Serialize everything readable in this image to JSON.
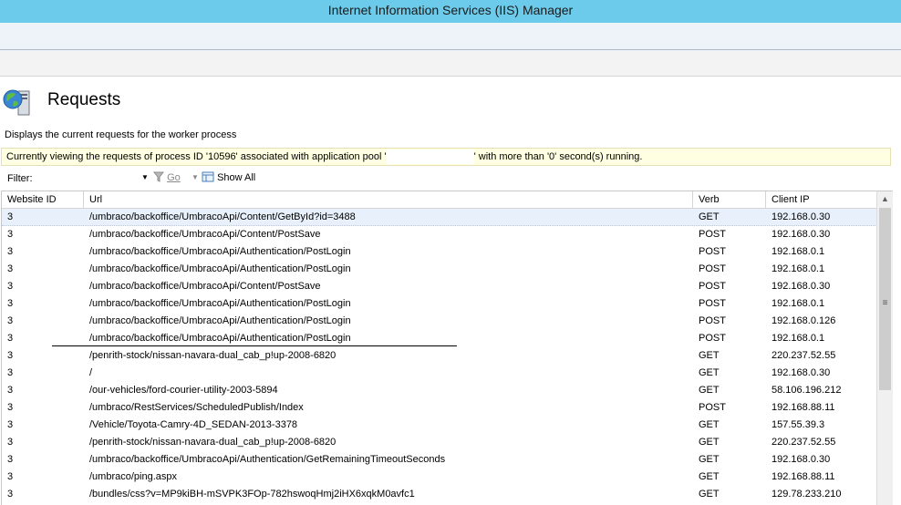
{
  "window": {
    "title": "Internet Information Services (IIS) Manager"
  },
  "page": {
    "title": "Requests",
    "description": "Displays the current requests for the worker process",
    "icon": "globe-server-icon"
  },
  "infobar": {
    "text_before": "Currently viewing the requests of process ID '10596' associated with application pool '",
    "text_after": "' with more than '0' second(s) running."
  },
  "filter": {
    "label": "Filter:",
    "value": "",
    "go_label": "Go",
    "show_all_label": "Show All"
  },
  "grid": {
    "columns": [
      "Website ID",
      "Url",
      "Verb",
      "Client IP"
    ],
    "rows": [
      [
        "3",
        "/umbraco/backoffice/UmbracoApi/Content/GetById?id=3488",
        "GET",
        "192.168.0.30"
      ],
      [
        "3",
        "/umbraco/backoffice/UmbracoApi/Content/PostSave",
        "POST",
        "192.168.0.30"
      ],
      [
        "3",
        "/umbraco/backoffice/UmbracoApi/Authentication/PostLogin",
        "POST",
        "192.168.0.1"
      ],
      [
        "3",
        "/umbraco/backoffice/UmbracoApi/Authentication/PostLogin",
        "POST",
        "192.168.0.1"
      ],
      [
        "3",
        "/umbraco/backoffice/UmbracoApi/Content/PostSave",
        "POST",
        "192.168.0.30"
      ],
      [
        "3",
        "/umbraco/backoffice/UmbracoApi/Authentication/PostLogin",
        "POST",
        "192.168.0.1"
      ],
      [
        "3",
        "/umbraco/backoffice/UmbracoApi/Authentication/PostLogin",
        "POST",
        "192.168.0.126"
      ],
      [
        "3",
        "/umbraco/backoffice/UmbracoApi/Authentication/PostLogin",
        "POST",
        "192.168.0.1"
      ],
      [
        "3",
        "/penrith-stock/nissan-navara-dual_cab_p!up-2008-6820",
        "GET",
        "220.237.52.55"
      ],
      [
        "3",
        "/",
        "GET",
        "192.168.0.30"
      ],
      [
        "3",
        "/our-vehicles/ford-courier-utility-2003-5894",
        "GET",
        "58.106.196.212"
      ],
      [
        "3",
        "/umbraco/RestServices/ScheduledPublish/Index",
        "POST",
        "192.168.88.11"
      ],
      [
        "3",
        "/Vehicle/Toyota-Camry-4D_SEDAN-2013-3378",
        "GET",
        "157.55.39.3"
      ],
      [
        "3",
        "/penrith-stock/nissan-navara-dual_cab_p!up-2008-6820",
        "GET",
        "220.237.52.55"
      ],
      [
        "3",
        "/umbraco/backoffice/UmbracoApi/Authentication/GetRemainingTimeoutSeconds",
        "GET",
        "192.168.0.30"
      ],
      [
        "3",
        "/umbraco/ping.aspx",
        "GET",
        "192.168.88.11"
      ],
      [
        "3",
        "/bundles/css?v=MP9kiBH-mSVPK3FOp-782hswoqHmj2iHX6xqkM0avfc1",
        "GET",
        "129.78.233.210"
      ]
    ]
  }
}
